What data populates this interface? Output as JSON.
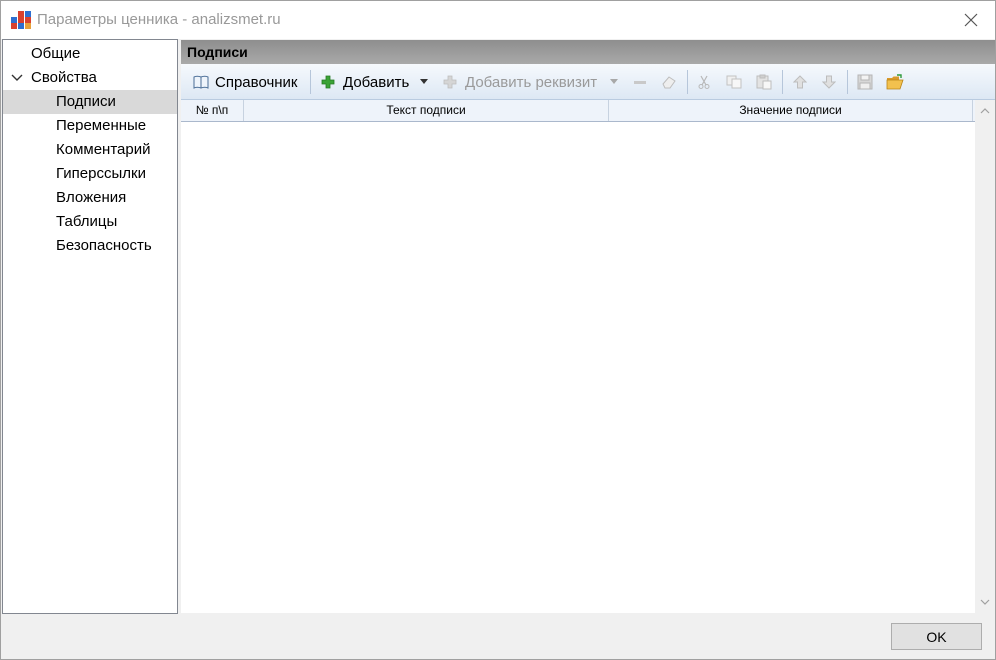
{
  "window": {
    "title": "Параметры ценника - analizsmet.ru",
    "close_icon": "close-icon",
    "app_icon": "grid-app-icon"
  },
  "sidebar": {
    "items": [
      {
        "label": "Общие",
        "level": 0,
        "expanded": null,
        "selected": false
      },
      {
        "label": "Свойства",
        "level": 0,
        "expanded": true,
        "selected": false
      },
      {
        "label": "Подписи",
        "level": 1,
        "selected": true
      },
      {
        "label": "Переменные",
        "level": 1,
        "selected": false
      },
      {
        "label": "Комментарий",
        "level": 1,
        "selected": false
      },
      {
        "label": "Гиперссылки",
        "level": 1,
        "selected": false
      },
      {
        "label": "Вложения",
        "level": 1,
        "selected": false
      },
      {
        "label": "Таблицы",
        "level": 1,
        "selected": false
      },
      {
        "label": "Безопасность",
        "level": 1,
        "selected": false
      }
    ]
  },
  "panel": {
    "title": "Подписи"
  },
  "toolbar": {
    "reference_label": "Справочник",
    "add_label": "Добавить",
    "add_requisite_label": "Добавить реквизит",
    "icons": [
      "book-icon",
      "plus-icon",
      "dropdown-arrow-icon",
      "plus-icon",
      "dropdown-arrow-icon",
      "minus-icon",
      "eraser-icon",
      "cut-icon",
      "copy-icon",
      "paste-icon",
      "arrow-up-icon",
      "arrow-down-icon",
      "save-icon",
      "open-folder-icon"
    ]
  },
  "grid": {
    "columns": [
      "№ п\\п",
      "Текст подписи",
      "Значение подписи"
    ],
    "rows": []
  },
  "footer": {
    "ok_label": "OK"
  },
  "colors": {
    "selection": "#d9d9d9",
    "panel_header": "#9a9a9a",
    "toolbar_top": "#f6f9fd",
    "toolbar_bottom": "#dde8f4",
    "add_icon_green": "#3aa335",
    "folder_yellow": "#e8b23a"
  }
}
